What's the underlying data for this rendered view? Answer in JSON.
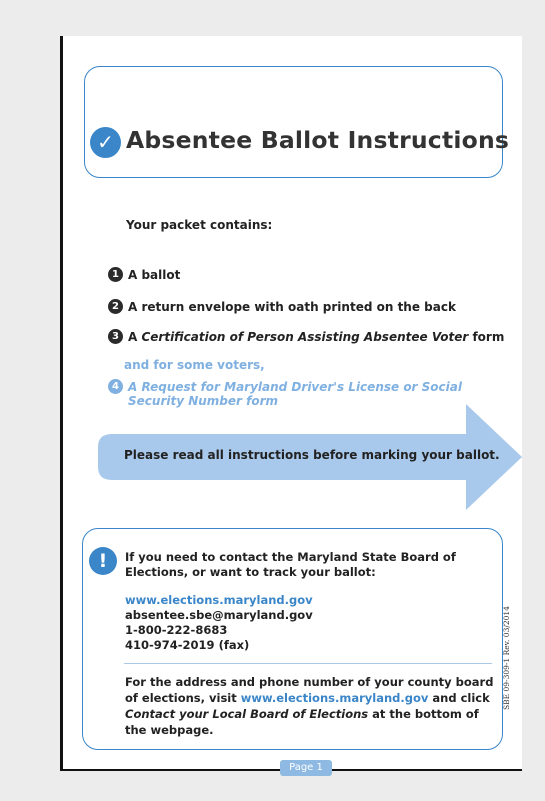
{
  "title": "Absentee Ballot Instructions",
  "packet": {
    "heading": "Your packet contains:",
    "items": [
      {
        "num": "1",
        "text": "A ballot"
      },
      {
        "num": "2",
        "text": "A return envelope with oath printed on the back"
      },
      {
        "num": "3",
        "text_pre": "A ",
        "text_italic": "Certification of Person Assisting Absentee Voter",
        "text_post": " form"
      },
      {
        "num": "4",
        "text": "A Request for Maryland Driver's License or Social Security Number form"
      }
    ],
    "some_voters": "and for some voters,"
  },
  "arrow_text": "Please read all instructions before marking your ballot.",
  "contact": {
    "heading": "If you need to contact the Maryland State Board of Elections, or want to track your ballot:",
    "website": "www.elections.maryland.gov",
    "email": "absentee.sbe@maryland.gov",
    "phone": "1-800-222-8683",
    "fax": "410-974-2019 (fax)"
  },
  "county": {
    "text_1": "For the address and phone number of your county board of elections, visit ",
    "link": "www.elections.maryland.gov",
    "text_2": " and click ",
    "italic": "Contact your Local Board of Elections",
    "text_3": " at the bottom of the webpage."
  },
  "page_label": "Page 1",
  "form_id": "SBE 09-309-1 Rev. 03/2014",
  "colors": {
    "accent": "#3a86c8",
    "light_accent": "#7fb0e0",
    "arrow": "#a9c9ec"
  }
}
